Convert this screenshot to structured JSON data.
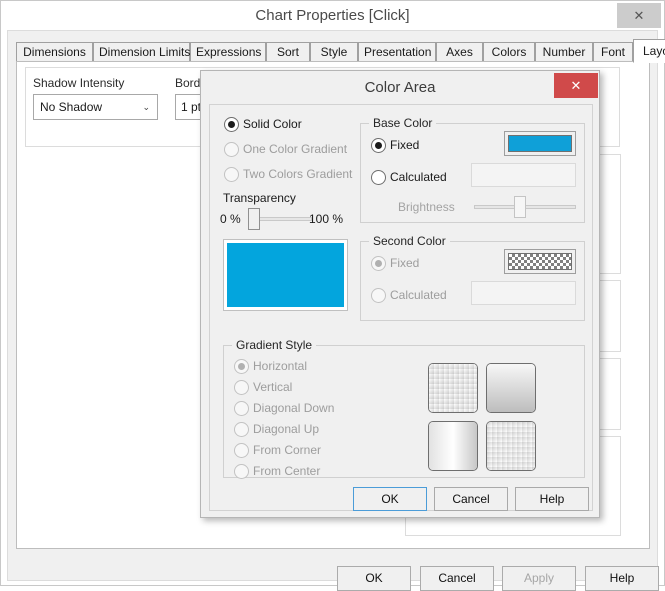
{
  "parent_window": {
    "title": "Chart Properties [Click]",
    "close_icon": "close-icon",
    "close_glyph": "✕",
    "tabs": [
      {
        "label": "Dimensions",
        "active": false
      },
      {
        "label": "Dimension Limits",
        "active": false
      },
      {
        "label": "Expressions",
        "active": false
      },
      {
        "label": "Sort",
        "active": false
      },
      {
        "label": "Style",
        "active": false
      },
      {
        "label": "Presentation",
        "active": false
      },
      {
        "label": "Axes",
        "active": false
      },
      {
        "label": "Colors",
        "active": false
      },
      {
        "label": "Number",
        "active": false
      },
      {
        "label": "Font",
        "active": false
      },
      {
        "label": "Layout",
        "active": true
      }
    ],
    "tab_scroll_left_glyph": "◀",
    "tab_scroll_right_glyph": "▶",
    "fields": {
      "shadow_intensity_label": "Shadow Intensity",
      "shadow_intensity_value": "No Shadow",
      "border_width_label": "Border W",
      "border_width_value": "1 pt",
      "caret_glyph": "⌄"
    },
    "buttons": {
      "ok": "OK",
      "cancel": "Cancel",
      "apply": "Apply",
      "help": "Help"
    }
  },
  "dialog": {
    "title": "Color Area",
    "close_glyph": "✕",
    "fill_type": {
      "options": [
        {
          "label": "Solid Color",
          "selected": true,
          "enabled": true
        },
        {
          "label": "One Color Gradient",
          "selected": false,
          "enabled": false
        },
        {
          "label": "Two Colors Gradient",
          "selected": false,
          "enabled": false
        }
      ]
    },
    "transparency": {
      "label": "Transparency",
      "min_label": "0 %",
      "max_label": "100 %",
      "value": 0
    },
    "preview_color": "#03a5dd",
    "base_color": {
      "title": "Base Color",
      "fixed_label": "Fixed",
      "fixed_selected": true,
      "calculated_label": "Calculated",
      "calculated_selected": false,
      "calculated_value": "",
      "swatch_color": "#0fa0d8",
      "brightness_label": "Brightness",
      "brightness_value": 50
    },
    "second_color": {
      "title": "Second Color",
      "fixed_label": "Fixed",
      "fixed_selected": true,
      "calculated_label": "Calculated",
      "calculated_selected": false,
      "calculated_value": "",
      "swatch_pattern": "checkerboard"
    },
    "gradient_style": {
      "title": "Gradient Style",
      "options": [
        {
          "label": "Horizontal",
          "selected": true
        },
        {
          "label": "Vertical",
          "selected": false
        },
        {
          "label": "Diagonal Down",
          "selected": false
        },
        {
          "label": "Diagonal Up",
          "selected": false
        },
        {
          "label": "From Corner",
          "selected": false
        },
        {
          "label": "From Center",
          "selected": false
        }
      ],
      "preview_tiles": [
        "checker-topleft",
        "gradient-vertical",
        "gradient-horizontal",
        "checker-bottomright"
      ]
    },
    "buttons": {
      "ok": "OK",
      "cancel": "Cancel",
      "help": "Help"
    }
  }
}
